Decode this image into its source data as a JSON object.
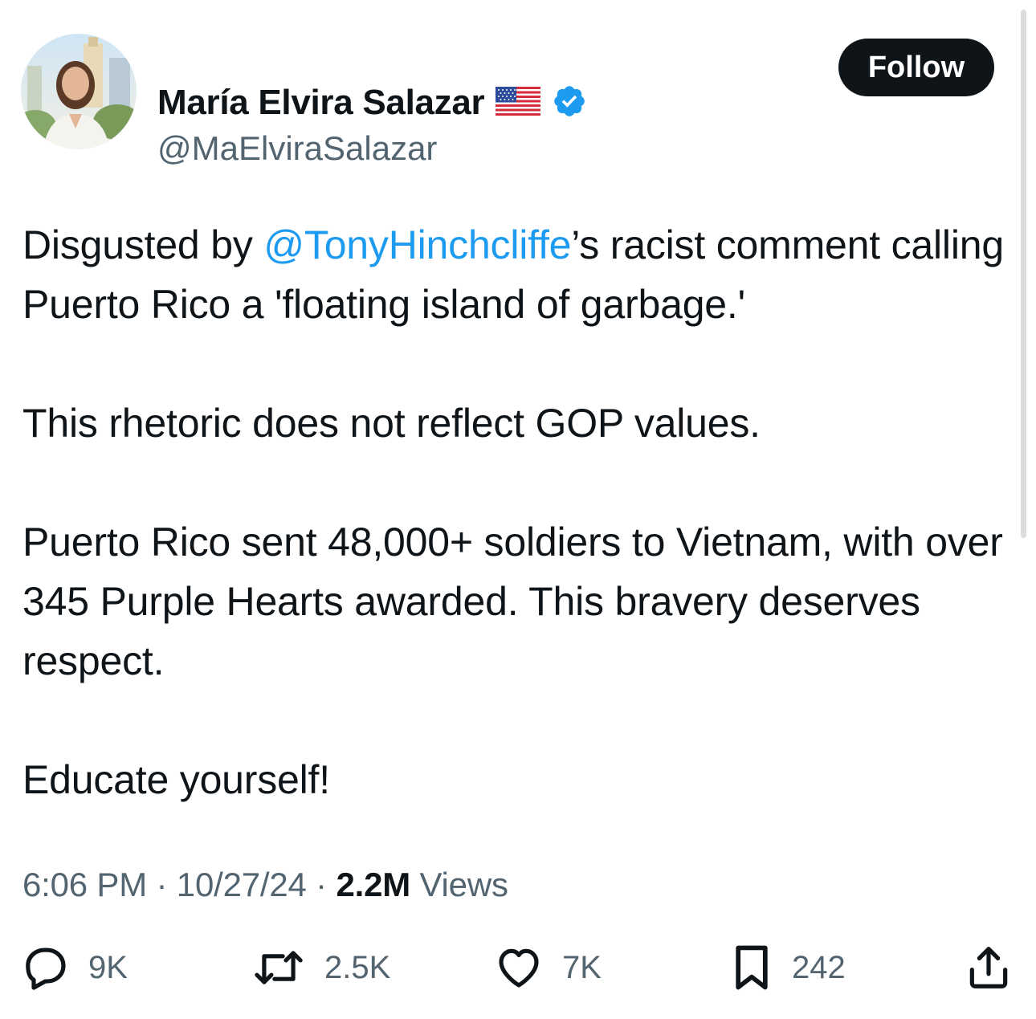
{
  "author": {
    "name": "María Elvira Salazar",
    "handle": "@MaElviraSalazar",
    "flag_icon": "us-flag-icon",
    "verified_icon": "verified-badge-icon",
    "verified_color": "#1d9bf0"
  },
  "follow_label": "Follow",
  "tweet": {
    "p1_before": "Disgusted by ",
    "p1_mention": "@TonyHinchcliffe",
    "p1_after": "’s racist comment calling Puerto Rico a 'floating island of garbage.'",
    "p2": "This rhetoric does not reflect GOP values.",
    "p3": "Puerto Rico sent 48,000+ soldiers to Vietnam, with over 345 Purple Hearts awarded. This bravery deserves respect.",
    "p4": "Educate yourself!"
  },
  "meta": {
    "time": "6:06 PM",
    "separator": "·",
    "date": "10/27/24",
    "views_count": "2.2M",
    "views_label": "Views"
  },
  "actions": {
    "replies": "9K",
    "reposts": "2.5K",
    "likes": "7K",
    "bookmarks": "242"
  },
  "colors": {
    "text": "#0f1419",
    "secondary": "#536471",
    "link": "#1d9bf0"
  }
}
